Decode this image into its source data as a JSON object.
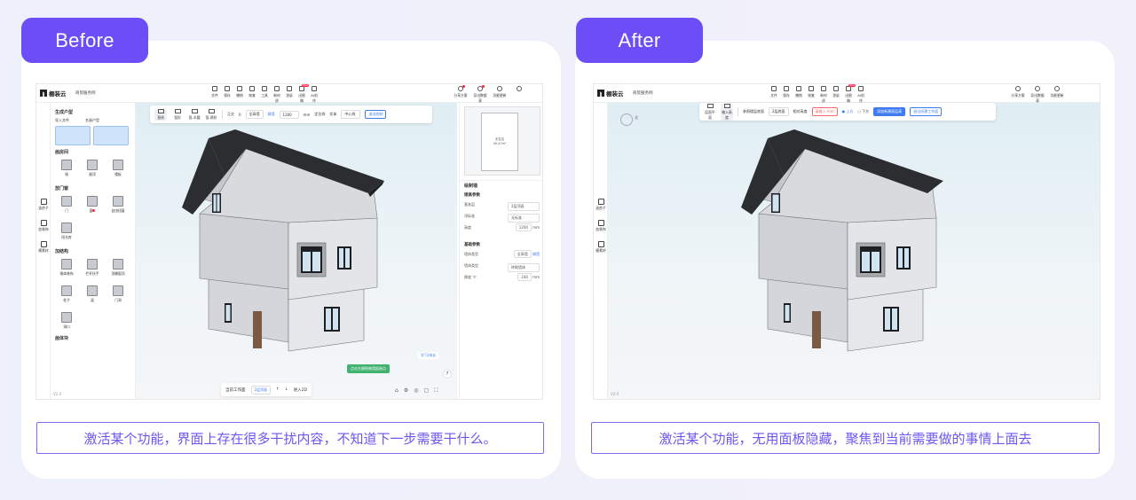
{
  "before": {
    "tag": "Before",
    "caption": "激活某个功能，界面上存在很多干扰内容，不知道下一步需要干什么。",
    "app": {
      "logo": "棚装云",
      "project": "商贸服务例",
      "tools": [
        {
          "label": "文件",
          "new": false,
          "dot": false
        },
        {
          "label": "保存",
          "new": false,
          "dot": false
        },
        {
          "label": "撤销",
          "new": false,
          "dot": false
        },
        {
          "label": "恢复",
          "new": false,
          "dot": false
        },
        {
          "label": "工具",
          "new": false,
          "dot": false
        },
        {
          "label": "新材质",
          "new": false,
          "dot": false
        },
        {
          "label": "渲染",
          "new": false,
          "dot": false
        },
        {
          "label": "出图稿",
          "new": true,
          "dot": false
        },
        {
          "label": "AI创作",
          "new": false,
          "dot": false
        }
      ],
      "new_badge": "New",
      "right_tools": [
        {
          "label": "分享方案",
          "dot": true
        },
        {
          "label": "导出数据表",
          "dot": true
        },
        {
          "label": "功能更新",
          "dot": false
        },
        {
          "label": "",
          "dot": false
        }
      ],
      "left_strip": [
        "选房子",
        "加装饰",
        "模素材"
      ],
      "left_panel": {
        "sections": [
          {
            "title": "生成户型",
            "subs": [
              "导入文件",
              "名画户型"
            ]
          },
          {
            "title": "画房间",
            "items": [
              "墙",
              "屋顶",
              "楼板"
            ]
          },
          {
            "title": "放门窗",
            "items": [
              "门",
              "窗",
              "自由扭窗",
              "阳光房"
            ]
          },
          {
            "title": "加结构",
            "items": [
              "墙体装饰",
              "栏杆扶手",
              "顶棚窗顶",
              "柱子",
              "梁",
              "门洞",
              "洞口"
            ]
          },
          {
            "title": "画体块",
            "items": []
          }
        ],
        "version": "V2.0"
      },
      "floatbar": {
        "tools": [
          "直线",
          "弧形",
          "弧-半圆",
          "弧-两阶"
        ],
        "dot_label": "正交",
        "dot_value": "0",
        "wall_mode": [
          "全高墙",
          "矮墙"
        ],
        "height": "1200",
        "height_unit": "mm",
        "position_label": "定位线",
        "position_prefix": "实体",
        "position_value": "中心线",
        "exit_btn": "退出绘制"
      },
      "minimap": {
        "room_name": "无名名",
        "area": "40.47m²"
      },
      "right_panel": {
        "title": "绘制墙",
        "sec1": "矮高参数",
        "rows1": [
          {
            "label": "基准层",
            "value": "2层顶面"
          },
          {
            "label": "顶标准",
            "value": "无标准"
          },
          {
            "label": "高度",
            "value": "1200",
            "unit": "mm"
          }
        ],
        "sec2": "基础参数",
        "rows2": [
          {
            "label": "墙体类型",
            "value": "全高墙",
            "alt": "矮墙"
          },
          {
            "label": "墙体类型",
            "value": "砖砌墙体"
          },
          {
            "label": "厚度",
            "value": "240",
            "unit": "mm"
          }
        ],
        "unit_c": "℃"
      },
      "bottombar": {
        "exit": "当前工作面",
        "floor": "2层顶面",
        "enter": "进入2D"
      },
      "green_hint": "点击左键绘制墙起始点",
      "learn": "学习/成长",
      "question": "?"
    }
  },
  "after": {
    "tag": "After",
    "caption": "激活某个功能，无用面板隐藏，聚焦到当前需要做的事情上面去",
    "app": {
      "logo": "棚装云",
      "project": "商贸服务例",
      "tools": [
        "文件",
        "保存",
        "撤销",
        "恢复",
        "新材质",
        "渲染",
        "出图稿",
        "AI创作"
      ],
      "new_badge": "New",
      "right_tools": [
        "分享方案",
        "导出数据表",
        "功能更新"
      ],
      "left_strip": [
        "选房子",
        "加装饰",
        "模素材"
      ],
      "floatbar": {
        "tools": [
          "层面平面",
          "输入高度"
        ],
        "ref_label": "参照楼层底面",
        "ref_value": "2层底面",
        "rel_label": "相对高度",
        "rel_placeholder": "请输入",
        "rel_unit": "mm",
        "up_label": "上方",
        "down_label": "下方",
        "confirm_btn": "添加新建面层高",
        "exit_btn": "退出创建工作面"
      },
      "version": "V2.0",
      "compass": "北"
    }
  }
}
